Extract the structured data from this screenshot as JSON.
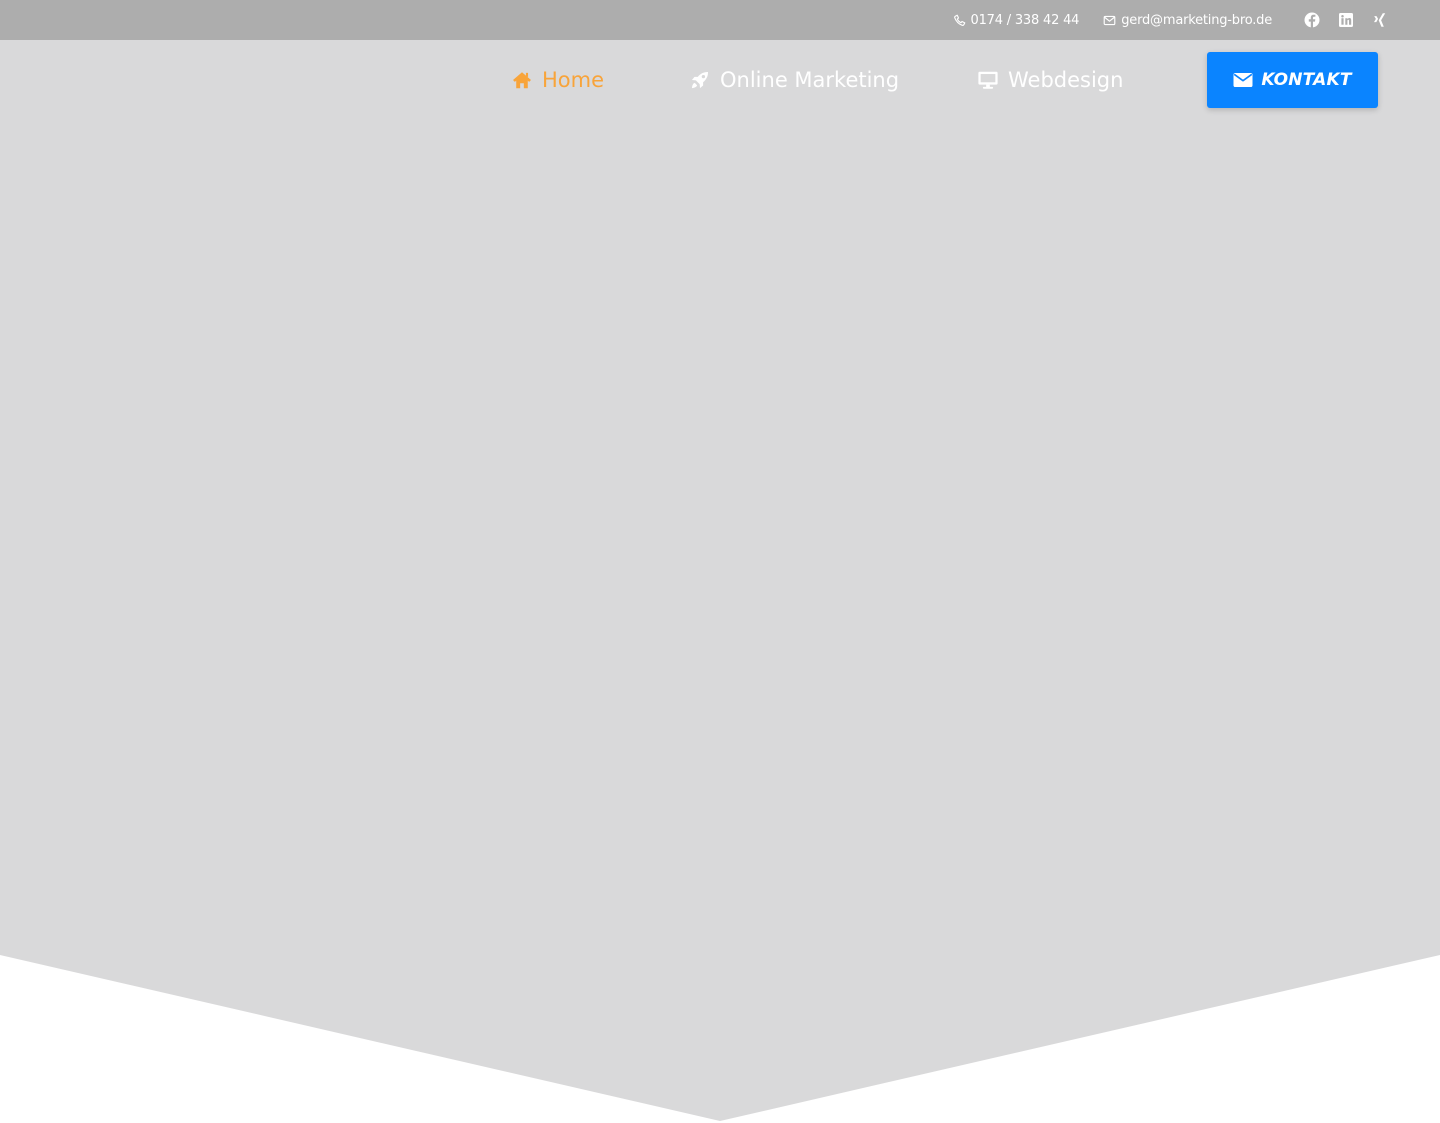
{
  "colors": {
    "topbar_background": "#adadad",
    "hero_background": "#d9d9da",
    "page_background": "#ffffff",
    "nav_text": "#ffffff",
    "nav_active": "#f8a43a",
    "button_background": "#0a84ff",
    "button_text": "#ffffff"
  },
  "topbar": {
    "phone": {
      "icon": "phone-icon",
      "text": "0174 / 338 42 44"
    },
    "email": {
      "icon": "envelope-icon",
      "text": "gerd@marketing-bro.de"
    },
    "social": [
      {
        "icon": "facebook-icon"
      },
      {
        "icon": "linkedin-icon"
      },
      {
        "icon": "xing-icon"
      }
    ]
  },
  "nav": {
    "items": [
      {
        "label": "Home",
        "icon": "home-icon",
        "active": true
      },
      {
        "label": "Online Marketing",
        "icon": "rocket-icon",
        "active": false
      },
      {
        "label": "Webdesign",
        "icon": "monitor-icon",
        "active": false
      }
    ],
    "contact_button": {
      "label": "Kontakt",
      "icon": "envelope-icon"
    }
  }
}
